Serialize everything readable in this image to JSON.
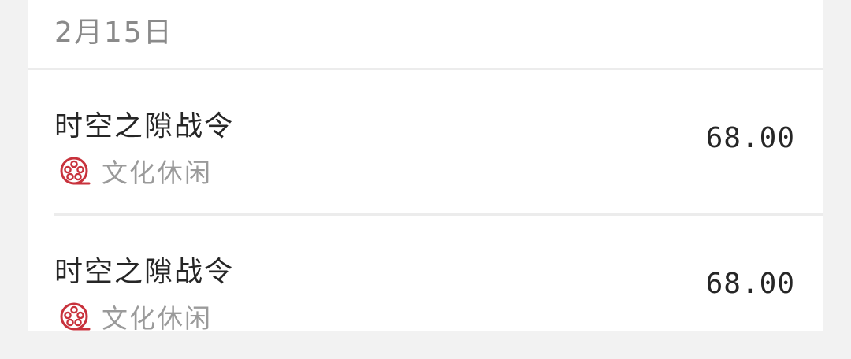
{
  "date_group": {
    "date": "2月15日"
  },
  "transactions": [
    {
      "title": "时空之隙战令",
      "category": "文化休闲",
      "category_icon": "film-reel-icon",
      "amount": "68.00"
    },
    {
      "title": "时空之隙战令",
      "category": "文化休闲",
      "category_icon": "film-reel-icon",
      "amount": "68.00"
    }
  ],
  "colors": {
    "category_icon": "#c8323c",
    "background": "#f2f2f2",
    "card": "#ffffff"
  }
}
